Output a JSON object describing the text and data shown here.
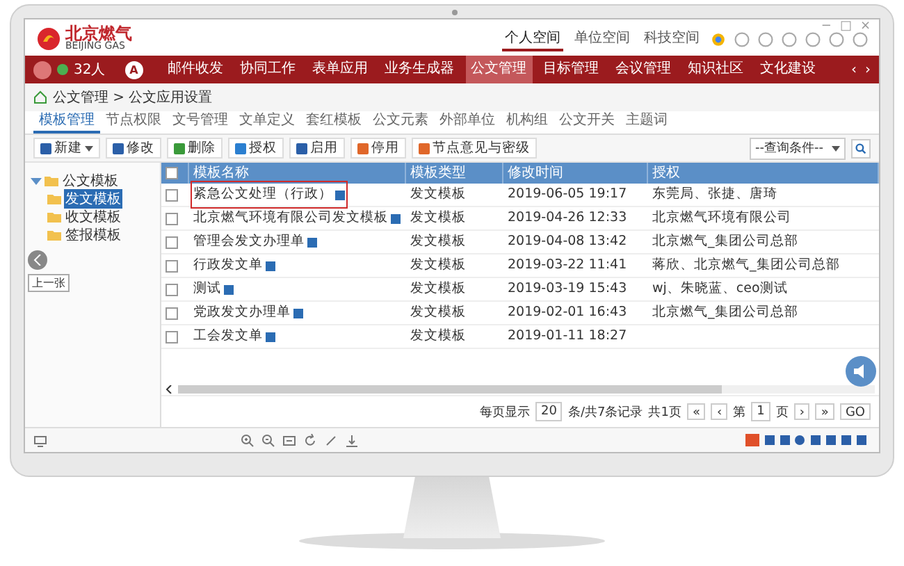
{
  "window_controls": [
    "−",
    "□",
    "×"
  ],
  "logo": {
    "name": "北京燃气",
    "subtitle": "BEIJING GAS"
  },
  "header_links": [
    {
      "label": "个人空间",
      "selected": true
    },
    {
      "label": "单位空间",
      "selected": false
    },
    {
      "label": "科技空间",
      "selected": false
    }
  ],
  "nav": {
    "user_count": "32人",
    "font_button": "A",
    "arrows": [
      "‹",
      "›"
    ],
    "items": [
      {
        "label": "邮件收发",
        "selected": false
      },
      {
        "label": "协同工作",
        "selected": false
      },
      {
        "label": "表单应用",
        "selected": false
      },
      {
        "label": "业务生成器",
        "selected": false
      },
      {
        "label": "公文管理",
        "selected": true
      },
      {
        "label": "目标管理",
        "selected": false
      },
      {
        "label": "会议管理",
        "selected": false
      },
      {
        "label": "知识社区",
        "selected": false
      },
      {
        "label": "文化建设",
        "selected": false
      }
    ]
  },
  "breadcrumb": "公文管理 > 公文应用设置",
  "tabs": [
    {
      "label": "模板管理",
      "selected": true
    },
    {
      "label": "节点权限",
      "selected": false
    },
    {
      "label": "文号管理",
      "selected": false
    },
    {
      "label": "文单定义",
      "selected": false
    },
    {
      "label": "套红模板",
      "selected": false
    },
    {
      "label": "公文元素",
      "selected": false
    },
    {
      "label": "外部单位",
      "selected": false
    },
    {
      "label": "机构组",
      "selected": false
    },
    {
      "label": "公文开关",
      "selected": false
    },
    {
      "label": "主题词",
      "selected": false
    }
  ],
  "toolbar": [
    {
      "label": "新建",
      "kind": "dropdown",
      "color": "#2b5fa8"
    },
    {
      "label": "修改",
      "kind": "button",
      "color": "#2b5fa8"
    },
    {
      "label": "删除",
      "kind": "button",
      "color": "#3a9a3a"
    },
    {
      "label": "授权",
      "kind": "button",
      "color": "#2b7fd0"
    },
    {
      "label": "启用",
      "kind": "button",
      "color": "#2b5fa8"
    },
    {
      "label": "停用",
      "kind": "button",
      "color": "#e0672a"
    },
    {
      "label": "节点意见与密级",
      "kind": "button",
      "color": "#e0672a"
    }
  ],
  "search_select": {
    "value": "--查询条件--"
  },
  "tree": {
    "label": "公文模板",
    "expanded": true,
    "children": [
      {
        "label": "发文模板",
        "selected": true
      },
      {
        "label": "收文模板",
        "selected": false
      },
      {
        "label": "签报模板",
        "selected": false
      }
    ]
  },
  "table": {
    "all_checked": false,
    "columns": [
      "模板名称",
      "模板类型",
      "修改时间",
      "授权"
    ],
    "rows": [
      {
        "checked": false,
        "highlighted": true,
        "name": "紧急公文处理（行政）",
        "type": "发文模板",
        "modified": "2019-06-05 19:17",
        "authorized": "东莞局、张捷、唐琦"
      },
      {
        "checked": false,
        "highlighted": false,
        "name": "北京燃气环境有限公司发文模板",
        "type": "发文模板",
        "modified": "2019-04-26 12:33",
        "authorized": "北京燃气环境有限公司"
      },
      {
        "checked": false,
        "highlighted": false,
        "name": "管理会发文办理单",
        "type": "发文模板",
        "modified": "2019-04-08 13:42",
        "authorized": "北京燃气_集团公司总部"
      },
      {
        "checked": false,
        "highlighted": false,
        "name": "行政发文单",
        "type": "发文模板",
        "modified": "2019-03-22 11:41",
        "authorized": "蒋欣、北京燃气_集团公司总部"
      },
      {
        "checked": false,
        "highlighted": false,
        "name": "测试",
        "type": "发文模板",
        "modified": "2019-03-19 15:43",
        "authorized": "wj、朱晓蓝、ceo测试"
      },
      {
        "checked": false,
        "highlighted": false,
        "name": "党政发文办理单",
        "type": "发文模板",
        "modified": "2019-02-01 16:43",
        "authorized": "北京燃气_集团公司总部"
      },
      {
        "checked": false,
        "highlighted": false,
        "name": "工会发文单",
        "type": "发文模板",
        "modified": "2019-01-11 18:27"
      }
    ]
  },
  "pager": {
    "page_size_label": "每页显示",
    "page_size": "20",
    "summary": "条/共7条记录",
    "pages": "共1页",
    "first": "«",
    "prev": "‹",
    "page_prefix": "第",
    "page": "1",
    "page_suffix": "页",
    "next": "›",
    "last": "»",
    "go": "GO"
  },
  "side_tooltip": "上一张"
}
